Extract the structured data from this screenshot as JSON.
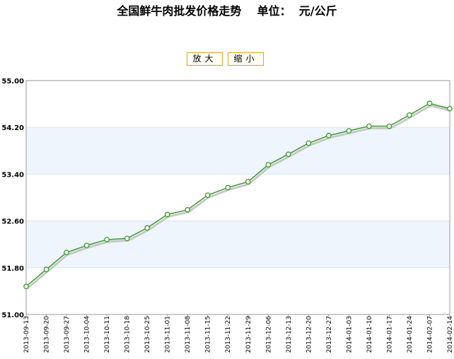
{
  "title": "全国鲜牛肉批发价格走势    单位：  元/公斤",
  "controls": {
    "zoom_in_label": "放大",
    "zoom_out_label": "缩小"
  },
  "colors": {
    "line": "#3a9a2a",
    "marker_fill": "#ffffff",
    "marker_stroke": "#3a9a2a",
    "shadow": "#c8c8c8",
    "band": "#eef5fc",
    "frame": "#999999",
    "grid": "#d8e6f2"
  },
  "chart_data": {
    "type": "line",
    "title": "全国鲜牛肉批发价格走势    单位：  元/公斤",
    "xlabel": "",
    "ylabel": "",
    "ylim": [
      51.0,
      55.0
    ],
    "yticks": [
      "51.00",
      "51.80",
      "52.60",
      "53.40",
      "54.20",
      "55.00"
    ],
    "x": [
      "2013-09-13",
      "2013-09-20",
      "2013-09-27",
      "2013-10-04",
      "2013-10-11",
      "2013-10-18",
      "2013-10-25",
      "2013-11-01",
      "2013-11-08",
      "2013-11-15",
      "2013-11-22",
      "2013-11-29",
      "2013-12-06",
      "2013-12-13",
      "2013-12-20",
      "2013-12-27",
      "2014-01-03",
      "2014-01-10",
      "2014-01-17",
      "2014-01-24",
      "2014-02-07",
      "2014-02-14"
    ],
    "series": [
      {
        "values": [
          51.48,
          51.77,
          52.06,
          52.18,
          52.28,
          52.3,
          52.48,
          52.71,
          52.79,
          53.04,
          53.17,
          53.27,
          53.56,
          53.74,
          53.93,
          54.06,
          54.14,
          54.22,
          54.22,
          54.41,
          54.61,
          54.52
        ]
      }
    ],
    "grid": true,
    "legend": "none"
  }
}
